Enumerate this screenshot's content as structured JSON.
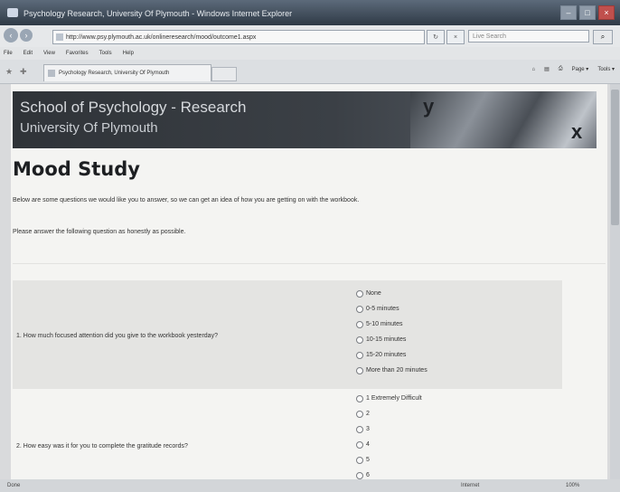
{
  "window": {
    "title": "Psychology Research, University Of Plymouth - Windows Internet Explorer",
    "buttons": {
      "minimize": "–",
      "maximize": "□",
      "close": "×"
    }
  },
  "toolbar": {
    "back": "‹",
    "forward": "›",
    "address": "http://www.psy.plymouth.ac.uk/onlineresearch/mood/outcome1.aspx",
    "refresh": "↻",
    "stop": "×",
    "search_placeholder": "Live Search",
    "search_button": "⌕"
  },
  "menu": {
    "items": [
      "File",
      "Edit",
      "View",
      "Favorites",
      "Tools",
      "Help"
    ]
  },
  "tabs": {
    "active_label": "Psychology Research, University Of Plymouth",
    "commands": [
      "Page ▾",
      "Tools ▾"
    ]
  },
  "banner": {
    "line1": "School of Psychology - Research",
    "line2": "University Of Plymouth",
    "glyph1": "y",
    "glyph2": "x"
  },
  "page": {
    "heading": "Mood Study",
    "intro": "Below are some questions we would like you to answer, so we can get an idea of how you are getting on with the workbook.",
    "instruction": "Please answer the following question as honestly as possible."
  },
  "questions": [
    {
      "text": "1. How much focused attention did you give to the workbook yesterday?",
      "options": [
        "None",
        "0-5 minutes",
        "5-10 minutes",
        "10-15 minutes",
        "15-20 minutes",
        "More than 20 minutes"
      ]
    },
    {
      "text": "2. How easy was it for you to complete the gratitude records?",
      "options": [
        "1 Extremely Difficult",
        "2",
        "3",
        "4",
        "5",
        "6"
      ]
    }
  ],
  "status": {
    "left": "Done",
    "zone": "Internet",
    "zoom": "100%"
  }
}
